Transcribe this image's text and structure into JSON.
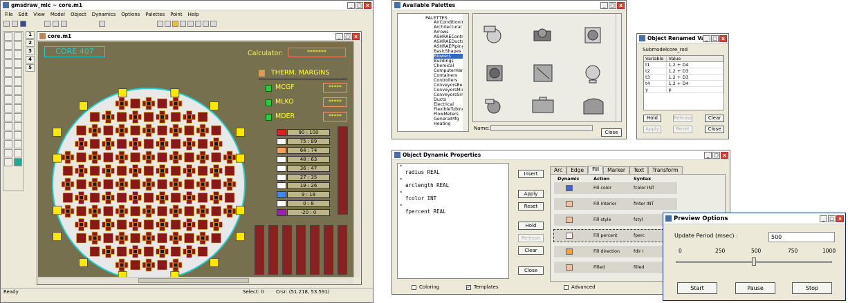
{
  "main": {
    "title": "gmsdraw_mlc ~ core.m1",
    "menu": [
      "File",
      "Edit",
      "View",
      "Model",
      "Object",
      "Dynamics",
      "Options",
      "Palettes",
      "Point",
      "Help"
    ],
    "num_tools": [
      "1",
      "2",
      "3",
      "4",
      "5"
    ],
    "status": {
      "ready": "Ready",
      "select": "Select: 0",
      "cursor": "Crsr: (51.218, 53.591)"
    }
  },
  "core": {
    "title": "core.m1",
    "label": "CORE 407",
    "calculator_label": "Calculator:",
    "calculator_value": "*******",
    "margins_label": "THERM. MARGINS",
    "margins": [
      {
        "label": "MCGF",
        "value": "*****"
      },
      {
        "label": "MLKO",
        "value": "*****"
      },
      {
        "label": "MDER",
        "value": "*****"
      }
    ],
    "legend": [
      {
        "text": "90 : 100",
        "color": "#e02020"
      },
      {
        "text": "75 : 89",
        "color": "#ffffff"
      },
      {
        "text": "64 : 74",
        "color": "#f4a060"
      },
      {
        "text": "48 : 63",
        "color": "#ffffff"
      },
      {
        "text": "36 : 47",
        "color": "#ffffff"
      },
      {
        "text": "27 : 35",
        "color": "#ffffff"
      },
      {
        "text": "19 : 26",
        "color": "#ffffff"
      },
      {
        "text": "9 : 18",
        "color": "#4488ee"
      },
      {
        "text": "0 : 8",
        "color": "#ffffff"
      },
      {
        "text": "-20 : 0",
        "color": "#9a20b0"
      }
    ]
  },
  "palettes": {
    "title": "Available Palettes",
    "tree_root": "PALETTES",
    "items": [
      "AirConditioning",
      "Architectural",
      "Arrows",
      "ASHRAEControls",
      "ASHRAEDucts",
      "ASHRAEPiping",
      "BasicShapes",
      "Blowers",
      "Buildings",
      "Chemical",
      "ComputerHardware",
      "Containers",
      "Controllers",
      "ConveyorsBelt",
      "ConveyorsMisc",
      "ConveyorsSimple",
      "Ducts",
      "Electrical",
      "FlexibleTubing",
      "FlowMeters",
      "GeneralMfg",
      "Heating"
    ],
    "selected": "Blowers",
    "name_label": "Name:",
    "close": "Close"
  },
  "renamed": {
    "title": "Object Renamed Vari...",
    "submodel_label": "Submodel:",
    "submodel": "core_rod",
    "headers": [
      "Variable",
      "Value"
    ],
    "rows": [
      [
        "t1",
        "1,2 + D4"
      ],
      [
        "t2",
        "1,2 + D3"
      ],
      [
        "t3",
        "1,2 + D3"
      ],
      [
        "t4",
        "1,2 + D4"
      ],
      [
        "y",
        "p"
      ]
    ],
    "hold": "Hold",
    "release": "Release",
    "clear": "Clear",
    "apply": "Apply",
    "reset": "Reset",
    "close": "Close"
  },
  "dyn": {
    "title": "Object Dynamic Properties",
    "vars": [
      "radius REAL",
      "arclength REAL",
      "fcolor INT",
      "fpercent REAL"
    ],
    "insert": "Insert",
    "apply": "Apply",
    "reset": "Reset",
    "hold": "Hold",
    "release": "Release",
    "clear": "Clear",
    "close": "Close",
    "tabs": [
      "Arc",
      "Edge",
      "Fill",
      "Marker",
      "Text",
      "Transform"
    ],
    "active_tab": "Fill",
    "headers": [
      "Dynamic",
      "Action",
      "Syntax"
    ],
    "rows": [
      {
        "action": "Fill color",
        "syntax": "fcolor INT"
      },
      {
        "action": "Fill interior",
        "syntax": "finter INT"
      },
      {
        "action": "Fill style",
        "syntax": "fstyl"
      },
      {
        "action": "Fill percent",
        "syntax": "fperc"
      },
      {
        "action": "Fill direction",
        "syntax": "fdir I"
      },
      {
        "action": "Filled",
        "syntax": "filled"
      }
    ],
    "coloring": "Coloring",
    "templates": "Templates",
    "advanced": "Advanced"
  },
  "preview": {
    "title": "Preview Options",
    "period_label": "Update Period (msec) :",
    "period": "500",
    "ticks": [
      "0",
      "250",
      "500",
      "750",
      "1000"
    ],
    "slider_value": 500,
    "start": "Start",
    "pause": "Pause",
    "stop": "Stop"
  }
}
